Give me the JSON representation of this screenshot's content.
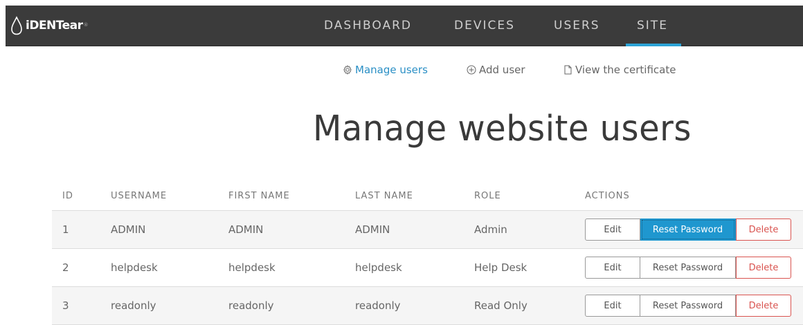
{
  "app": {
    "brand": "iDENTear",
    "brand_mark": "®"
  },
  "nav": {
    "items": [
      {
        "label": "DASHBOARD"
      },
      {
        "label": "DEVICES"
      },
      {
        "label": "USERS"
      },
      {
        "label": "SITE"
      }
    ],
    "active": "SITE",
    "accent_color": "#2ba3d6"
  },
  "subnav": {
    "manage": {
      "label": "Manage users",
      "icon": "gear-icon"
    },
    "add": {
      "label": "Add user",
      "icon": "plus-circle-icon"
    },
    "cert": {
      "label": "View the certificate",
      "icon": "document-icon"
    }
  },
  "page": {
    "title": "Manage website users"
  },
  "table": {
    "headers": {
      "id": "ID",
      "username": "USERNAME",
      "first_name": "FIRST NAME",
      "last_name": "LAST NAME",
      "role": "ROLE",
      "actions": "ACTIONS"
    },
    "rows": [
      {
        "id": "1",
        "username": "ADMIN",
        "first_name": "ADMIN",
        "last_name": "ADMIN",
        "role": "Admin"
      },
      {
        "id": "2",
        "username": "helpdesk",
        "first_name": "helpdesk",
        "last_name": "helpdesk",
        "role": "Help Desk"
      },
      {
        "id": "3",
        "username": "readonly",
        "first_name": "readonly",
        "last_name": "readonly",
        "role": "Read Only"
      }
    ],
    "actions": {
      "edit": "Edit",
      "reset": "Reset Password",
      "delete": "Delete"
    }
  },
  "colors": {
    "topbar": "#3b3b3b",
    "link": "#2a8fc5",
    "danger": "#d9534f",
    "primary": "#1f97cf"
  }
}
